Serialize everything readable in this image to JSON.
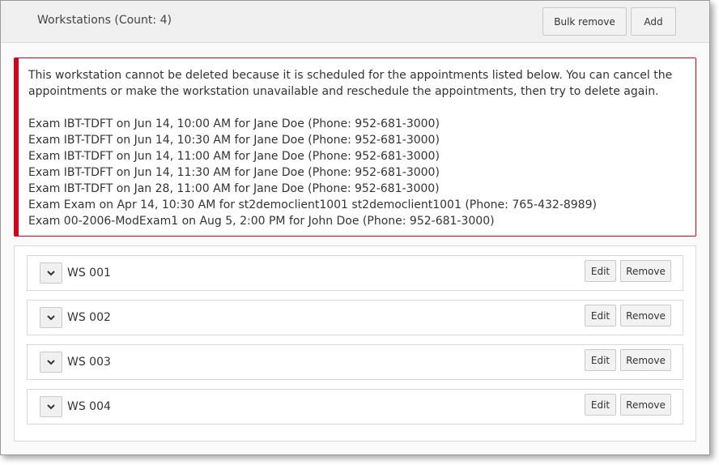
{
  "header": {
    "title": "Workstations (Count: 4)",
    "bulk_remove_label": "Bulk remove",
    "add_label": "Add"
  },
  "alert": {
    "accent_color": "#d9001b",
    "message": "This workstation cannot be deleted because it is scheduled for the appointments listed below. You can cancel the appointments or make the workstation unavailable and reschedule the appointments, then try to delete again.",
    "appointments": [
      "Exam IBT-TDFT on Jun 14, 10:00 AM for Jane Doe (Phone: 952-681-3000)",
      "Exam IBT-TDFT on Jun 14, 10:30 AM for Jane Doe (Phone: 952-681-3000)",
      "Exam IBT-TDFT on Jun 14, 11:00 AM for Jane Doe (Phone: 952-681-3000)",
      "Exam IBT-TDFT on Jun 14, 11:30 AM for Jane Doe (Phone: 952-681-3000)",
      "Exam IBT-TDFT on Jan 28, 11:00 AM for Jane Doe (Phone: 952-681-3000)",
      "Exam Exam on Apr 14, 10:30 AM for st2democlient1001 st2democlient1001 (Phone: 765-432-8989)",
      "Exam 00-2006-ModExam1 on Aug 5, 2:00 PM for John Doe (Phone: 952-681-3000)"
    ]
  },
  "workstations": [
    {
      "name": "WS 001",
      "edit_label": "Edit",
      "remove_label": "Remove",
      "icon": "chevron-down-icon"
    },
    {
      "name": "WS 002",
      "edit_label": "Edit",
      "remove_label": "Remove",
      "icon": "chevron-down-icon"
    },
    {
      "name": "WS 003",
      "edit_label": "Edit",
      "remove_label": "Remove",
      "icon": "chevron-down-icon"
    },
    {
      "name": "WS 004",
      "edit_label": "Edit",
      "remove_label": "Remove",
      "icon": "chevron-down-icon"
    }
  ]
}
